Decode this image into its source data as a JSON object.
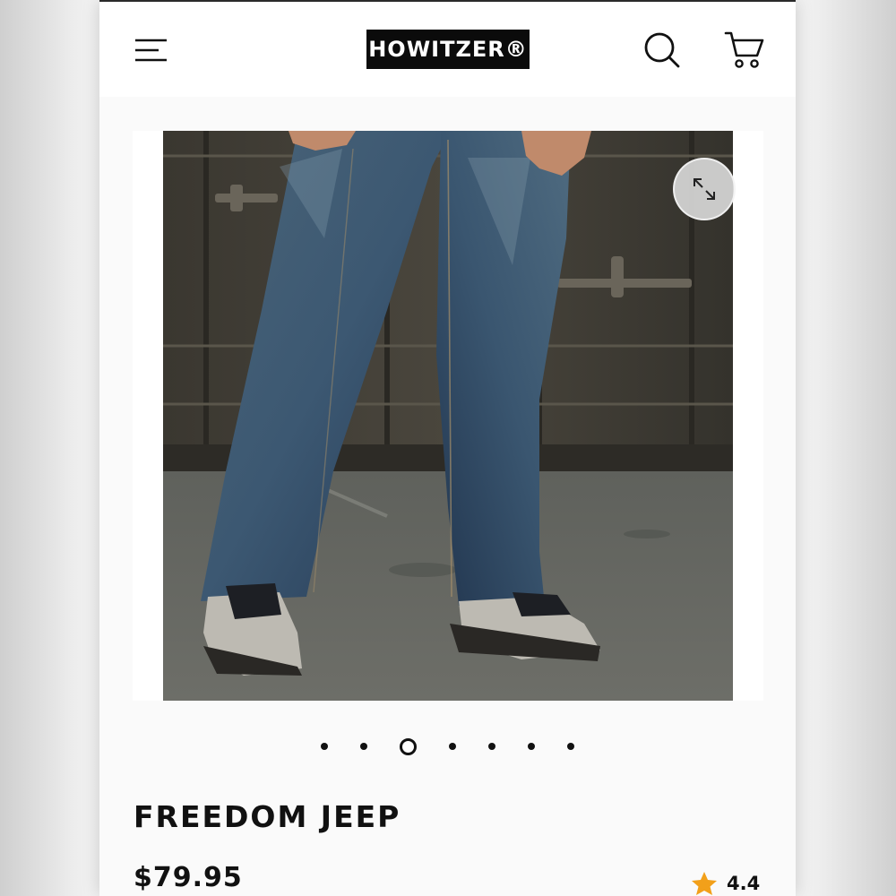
{
  "header": {
    "logo_text": "HOWITZER®",
    "menu_icon": "hamburger-menu-icon",
    "search_icon": "search-icon",
    "cart_icon": "shopping-cart-icon"
  },
  "gallery": {
    "expand_icon": "expand-arrows-icon",
    "dot_count": 7,
    "active_index": 2
  },
  "product": {
    "name": "FREEDOM JEEP",
    "price": "$79.95",
    "rating": "4.4",
    "rating_icon": "star-icon",
    "rating_color": "#f2a01a"
  },
  "colors": {
    "logo_bg": "#0b0b0b",
    "text": "#111111",
    "surface": "#fafafa"
  }
}
